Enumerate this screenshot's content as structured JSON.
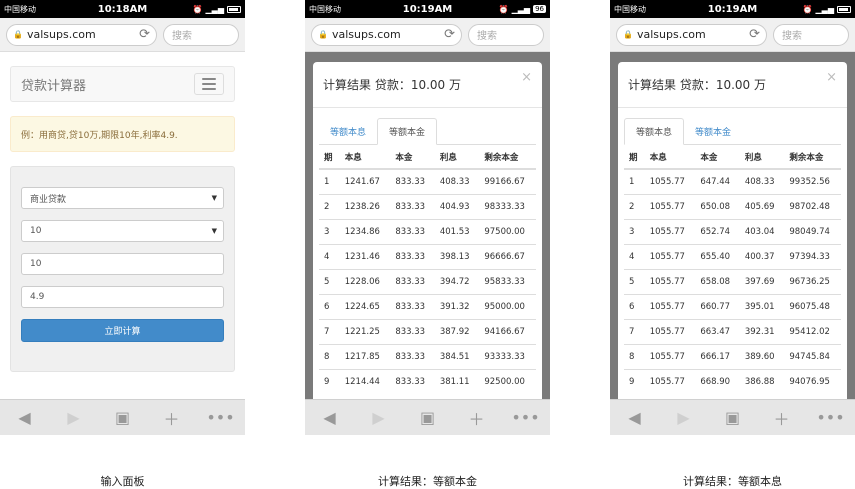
{
  "status": {
    "carrier": "中国移动",
    "battery_label": "96"
  },
  "browser": {
    "url": "valsups.com",
    "search_placeholder": "搜索"
  },
  "panels": [
    {
      "time": "10:18AM",
      "caption": "输入面板"
    },
    {
      "time": "10:19AM",
      "caption": "计算结果：等额本金"
    },
    {
      "time": "10:19AM",
      "caption": "计算结果：等额本息"
    }
  ],
  "calc": {
    "brand": "贷款计算器",
    "alert": "例：用商贷,贷10万,期限10年,利率4.9.",
    "loan_type": "商业贷款",
    "years_select": "10",
    "amount_value": "10",
    "rate_value": "4.9",
    "submit_label": "立即计算"
  },
  "result": {
    "title": "计算结果 贷款：10.00 万",
    "close": "×",
    "tab_equal_interest": "等额本息",
    "tab_equal_principal": "等额本金",
    "headers": [
      "期",
      "本息",
      "本金",
      "利息",
      "剩余本金"
    ]
  },
  "principal_rows": [
    [
      "1",
      "1241.67",
      "833.33",
      "408.33",
      "99166.67"
    ],
    [
      "2",
      "1238.26",
      "833.33",
      "404.93",
      "98333.33"
    ],
    [
      "3",
      "1234.86",
      "833.33",
      "401.53",
      "97500.00"
    ],
    [
      "4",
      "1231.46",
      "833.33",
      "398.13",
      "96666.67"
    ],
    [
      "5",
      "1228.06",
      "833.33",
      "394.72",
      "95833.33"
    ],
    [
      "6",
      "1224.65",
      "833.33",
      "391.32",
      "95000.00"
    ],
    [
      "7",
      "1221.25",
      "833.33",
      "387.92",
      "94166.67"
    ],
    [
      "8",
      "1217.85",
      "833.33",
      "384.51",
      "93333.33"
    ],
    [
      "9",
      "1214.44",
      "833.33",
      "381.11",
      "92500.00"
    ]
  ],
  "interest_rows": [
    [
      "1",
      "1055.77",
      "647.44",
      "408.33",
      "99352.56"
    ],
    [
      "2",
      "1055.77",
      "650.08",
      "405.69",
      "98702.48"
    ],
    [
      "3",
      "1055.77",
      "652.74",
      "403.04",
      "98049.74"
    ],
    [
      "4",
      "1055.77",
      "655.40",
      "400.37",
      "97394.33"
    ],
    [
      "5",
      "1055.77",
      "658.08",
      "397.69",
      "96736.25"
    ],
    [
      "6",
      "1055.77",
      "660.77",
      "395.01",
      "96075.48"
    ],
    [
      "7",
      "1055.77",
      "663.47",
      "392.31",
      "95412.02"
    ],
    [
      "8",
      "1055.77",
      "666.17",
      "389.60",
      "94745.84"
    ],
    [
      "9",
      "1055.77",
      "668.90",
      "386.88",
      "94076.95"
    ]
  ]
}
